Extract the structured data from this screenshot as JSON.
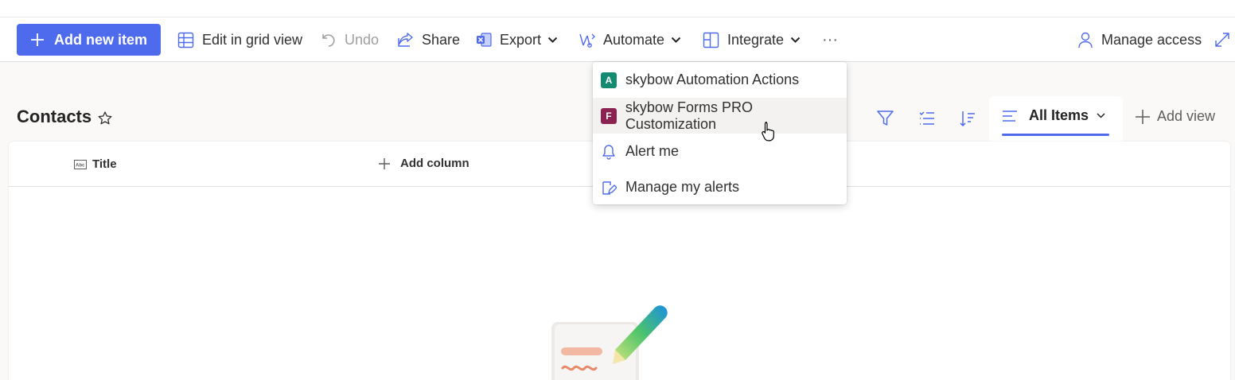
{
  "toolbar": {
    "add_new_item": "Add new item",
    "edit_grid": "Edit in grid view",
    "undo": "Undo",
    "share": "Share",
    "export": "Export",
    "automate": "Automate",
    "integrate": "Integrate",
    "more": "···",
    "manage_access": "Manage access"
  },
  "automate_menu": {
    "items": [
      {
        "label": "skybow Automation Actions",
        "icon": "skybow-automation-app-icon",
        "icon_letter": "A",
        "icon_color": "#138a72"
      },
      {
        "label": "skybow Forms PRO Customization",
        "icon": "skybow-forms-app-icon",
        "icon_letter": "F",
        "icon_color": "#8b2252"
      },
      {
        "label": "Alert me",
        "icon": "bell-icon"
      },
      {
        "label": "Manage my alerts",
        "icon": "edit-alert-icon"
      }
    ],
    "hovered_index": 1
  },
  "page": {
    "title": "Contacts"
  },
  "view": {
    "current_view": "All Items",
    "add_view": "Add view"
  },
  "list": {
    "columns": [
      "Title"
    ],
    "add_column": "Add column"
  },
  "colors": {
    "accent": "#4f6bed",
    "text": "#242424",
    "background": "#faf9f8"
  }
}
